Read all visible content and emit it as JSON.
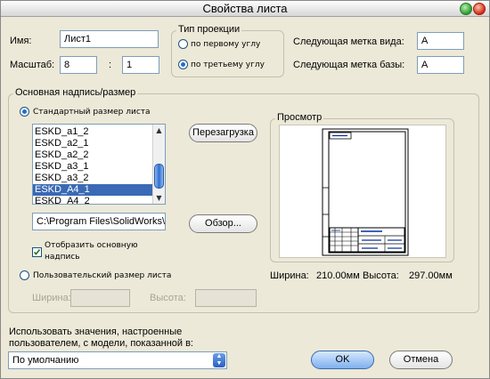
{
  "window": {
    "title": "Свойства листа"
  },
  "name": {
    "label": "Имя:",
    "value": "Лист1"
  },
  "scale": {
    "label": "Масштаб:",
    "numerator": "8",
    "separator": ":",
    "denominator": "1"
  },
  "projection": {
    "legend": "Тип проекции",
    "first_angle_label": "по первому углу",
    "third_angle_label": "по третьему углу",
    "selected": "third"
  },
  "next_view_label": {
    "label": "Следующая метка вида:",
    "value": "A"
  },
  "next_datum_label": {
    "label": "Следующая метка базы:",
    "value": "A"
  },
  "sheet_format": {
    "legend": "Основная надпись/размер",
    "standard_radio_label": "Стандартный размер листа",
    "items": [
      "ESKD_a1_2",
      "ESKD_a2_1",
      "ESKD_a2_2",
      "ESKD_a3_1",
      "ESKD_a3_2",
      "ESKD_A4_1",
      "ESKD_A4_2"
    ],
    "selected_item": "ESKD_A4_1",
    "reload_label": "Перезагрузка",
    "path_value": "C:\\Program Files\\SolidWorks\\",
    "browse_label": "Обзор...",
    "display_format_label_line1": "Отобразить основную",
    "display_format_label_line2": "надпись",
    "display_format_checked": true,
    "custom_radio_label": "Пользовательский размер листа",
    "custom_width_label": "Ширина:",
    "custom_height_label": "Высота:"
  },
  "preview": {
    "legend": "Просмотр",
    "width_label": "Ширина:",
    "width_value": "210.00мм",
    "height_label": "Высота:",
    "height_value": "297.00мм"
  },
  "model_source": {
    "label_line1": "Использовать значения, настроенные",
    "label_line2": "пользователем, с модели, показанной в:",
    "selected": "По умолчанию"
  },
  "buttons": {
    "ok": "OK",
    "cancel": "Отмена"
  }
}
